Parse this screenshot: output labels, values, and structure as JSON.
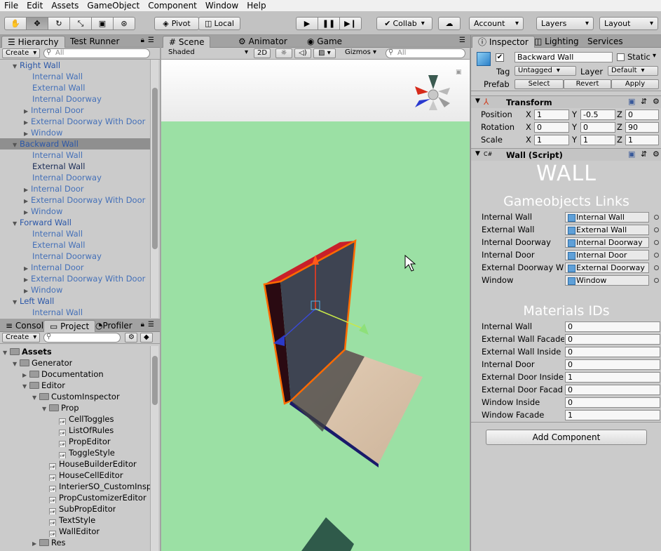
{
  "menu": [
    "File",
    "Edit",
    "Assets",
    "GameObject",
    "Component",
    "Window",
    "Help"
  ],
  "toolbar": {
    "pivot": "Pivot",
    "local": "Local",
    "collab": "Collab",
    "account": "Account",
    "layers": "Layers",
    "layout": "Layout"
  },
  "hierarchy": {
    "tabs": [
      "Hierarchy",
      "Test Runner"
    ],
    "create": "Create",
    "search_placeholder": "All",
    "rows": [
      {
        "label": "Right Wall",
        "level": 0,
        "expanded": true,
        "style": "blue"
      },
      {
        "label": "Internal Wall",
        "level": 1,
        "style": "child"
      },
      {
        "label": "External Wall",
        "level": 1,
        "style": "child"
      },
      {
        "label": "Internal Doorway",
        "level": 1,
        "style": "child"
      },
      {
        "label": "Internal Door",
        "level": 1,
        "collapsed": true,
        "style": "child"
      },
      {
        "label": "External Doorway With Door",
        "level": 1,
        "collapsed": true,
        "style": "child"
      },
      {
        "label": "Window",
        "level": 1,
        "collapsed": true,
        "style": "child"
      },
      {
        "label": "Backward Wall",
        "level": 0,
        "expanded": true,
        "style": "blue",
        "selected": true
      },
      {
        "label": "Internal Wall",
        "level": 1,
        "style": "child"
      },
      {
        "label": "External Wall",
        "level": 1,
        "style": "dark"
      },
      {
        "label": "Internal Doorway",
        "level": 1,
        "style": "child"
      },
      {
        "label": "Internal Door",
        "level": 1,
        "collapsed": true,
        "style": "child"
      },
      {
        "label": "External Doorway With Door",
        "level": 1,
        "collapsed": true,
        "style": "child"
      },
      {
        "label": "Window",
        "level": 1,
        "collapsed": true,
        "style": "child"
      },
      {
        "label": "Forward Wall",
        "level": 0,
        "expanded": true,
        "style": "blue"
      },
      {
        "label": "Internal Wall",
        "level": 1,
        "style": "child"
      },
      {
        "label": "External Wall",
        "level": 1,
        "style": "child"
      },
      {
        "label": "Internal Doorway",
        "level": 1,
        "style": "child"
      },
      {
        "label": "Internal Door",
        "level": 1,
        "collapsed": true,
        "style": "child"
      },
      {
        "label": "External Doorway With Door",
        "level": 1,
        "collapsed": true,
        "style": "child"
      },
      {
        "label": "Window",
        "level": 1,
        "collapsed": true,
        "style": "child"
      },
      {
        "label": "Left Wall",
        "level": 0,
        "expanded": true,
        "style": "blue"
      },
      {
        "label": "Internal Wall",
        "level": 1,
        "style": "child"
      }
    ]
  },
  "project": {
    "tabs": [
      "Console",
      "Project",
      "Profiler"
    ],
    "create": "Create",
    "rows": [
      {
        "label": "Assets",
        "level": 0,
        "type": "folder",
        "bold": true,
        "expanded": true
      },
      {
        "label": "Generator",
        "level": 1,
        "type": "folder",
        "expanded": true
      },
      {
        "label": "Documentation",
        "level": 2,
        "type": "folder",
        "collapsed": true
      },
      {
        "label": "Editor",
        "level": 2,
        "type": "folder",
        "expanded": true
      },
      {
        "label": "CustomInspector",
        "level": 3,
        "type": "folder",
        "expanded": true
      },
      {
        "label": "Prop",
        "level": 4,
        "type": "folder",
        "expanded": true
      },
      {
        "label": "CellToggles",
        "level": 5,
        "type": "cs"
      },
      {
        "label": "ListOfRules",
        "level": 5,
        "type": "cs"
      },
      {
        "label": "PropEditor",
        "level": 5,
        "type": "cs"
      },
      {
        "label": "ToggleStyle",
        "level": 5,
        "type": "cs"
      },
      {
        "label": "HouseBuilderEditor",
        "level": 4,
        "type": "cs"
      },
      {
        "label": "HouseCellEditor",
        "level": 4,
        "type": "cs"
      },
      {
        "label": "InterierSO_CustomInspector",
        "level": 4,
        "type": "cs"
      },
      {
        "label": "PropCustomizerEditor",
        "level": 4,
        "type": "cs"
      },
      {
        "label": "SubPropEditor",
        "level": 4,
        "type": "cs"
      },
      {
        "label": "TextStyle",
        "level": 4,
        "type": "cs"
      },
      {
        "label": "WallEditor",
        "level": 4,
        "type": "cs"
      },
      {
        "label": "Res",
        "level": 3,
        "type": "folder",
        "collapsed": true
      }
    ]
  },
  "scene": {
    "tabs": [
      "Scene",
      "Animator",
      "Game"
    ],
    "shading": "Shaded",
    "mode_2d": "2D",
    "gizmos": "Gizmos",
    "search_placeholder": "All"
  },
  "inspector": {
    "tabs": [
      "Inspector",
      "Lighting",
      "Services"
    ],
    "object_name": "Backward Wall",
    "static_label": "Static",
    "tag_label": "Tag",
    "tag_value": "Untagged",
    "layer_label": "Layer",
    "layer_value": "Default",
    "prefab_label": "Prefab",
    "prefab_buttons": [
      "Select",
      "Revert",
      "Apply"
    ],
    "transform": {
      "title": "Transform",
      "rows": [
        {
          "label": "Position",
          "x": "1",
          "y": "-0.5",
          "z": "0"
        },
        {
          "label": "Rotation",
          "x": "0",
          "y": "0",
          "z": "90"
        },
        {
          "label": "Scale",
          "x": "1",
          "y": "1",
          "z": "1"
        }
      ]
    },
    "script": {
      "title": "Wall (Script)",
      "big_title": "WALL",
      "links_title": "Gameobjects Links",
      "links": [
        {
          "label": "Internal Wall",
          "value": "Internal Wall"
        },
        {
          "label": "External Wall",
          "value": "External Wall"
        },
        {
          "label": "Internal Doorway",
          "value": "Internal Doorway"
        },
        {
          "label": "Internal Door",
          "value": "Internal Door"
        },
        {
          "label": "External Doorway W",
          "value": "External Doorway"
        },
        {
          "label": "Window",
          "value": "Window"
        }
      ],
      "materials_title": "Materials IDs",
      "materials": [
        {
          "label": "Internal Wall",
          "value": "0"
        },
        {
          "label": "External Wall Facade",
          "value": "0"
        },
        {
          "label": "External Wall Inside",
          "value": "0"
        },
        {
          "label": "Internal Door",
          "value": "0"
        },
        {
          "label": "External Door Inside",
          "value": "1"
        },
        {
          "label": "External Door Facad",
          "value": "0"
        },
        {
          "label": "Window Inside",
          "value": "0"
        },
        {
          "label": "Window Facade",
          "value": "1"
        }
      ]
    },
    "add_component": "Add Component"
  },
  "colors": {
    "sky": "#f2f2f2",
    "ground": "#9be0a4",
    "selection_outline": "#ff6a00",
    "wall_top": "#c8202a",
    "wall_face": "#3e4452",
    "floor": "#d8c2aa"
  }
}
